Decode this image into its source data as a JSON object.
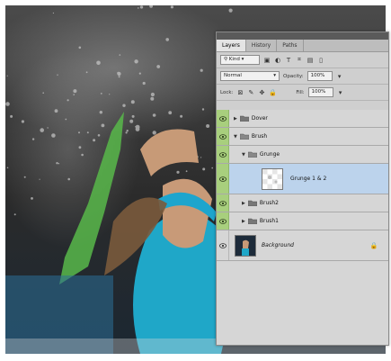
{
  "layers_panel": {
    "tabs": [
      {
        "label": "Layers"
      },
      {
        "label": "History"
      },
      {
        "label": "Paths"
      }
    ],
    "kind_filter": "Kind",
    "blend_mode": "Normal",
    "opacity_label": "Opacity:",
    "opacity_value": "100%",
    "lock_label": "Lock:",
    "fill_label": "Fill:",
    "fill_value": "100%",
    "layers": [
      {
        "name": "Dover",
        "type": "group"
      },
      {
        "name": "Brush",
        "type": "group"
      },
      {
        "name": "Grunge",
        "type": "group"
      },
      {
        "name": "Grunge 1 & 2",
        "type": "layer",
        "selected": true
      },
      {
        "name": "Brush2",
        "type": "group"
      },
      {
        "name": "Brush1",
        "type": "group"
      },
      {
        "name": "Background",
        "type": "background"
      }
    ]
  },
  "icons": [
    "search-icon",
    "pixel-filter-icon",
    "adjustment-filter-icon",
    "type-filter-icon",
    "shape-filter-icon",
    "smart-object-filter-icon",
    "lock-transparency-icon",
    "lock-pixels-icon",
    "lock-position-icon",
    "lock-all-icon",
    "eye-icon",
    "folder-icon",
    "lock-icon"
  ],
  "colors": {
    "panel_bg": "#d6d6d6",
    "visibility_green": "#a8cf7d",
    "selected_row": "#bcd3ec",
    "photo_top": "#4d4d4d",
    "photo_bottom": "#1b2732"
  }
}
